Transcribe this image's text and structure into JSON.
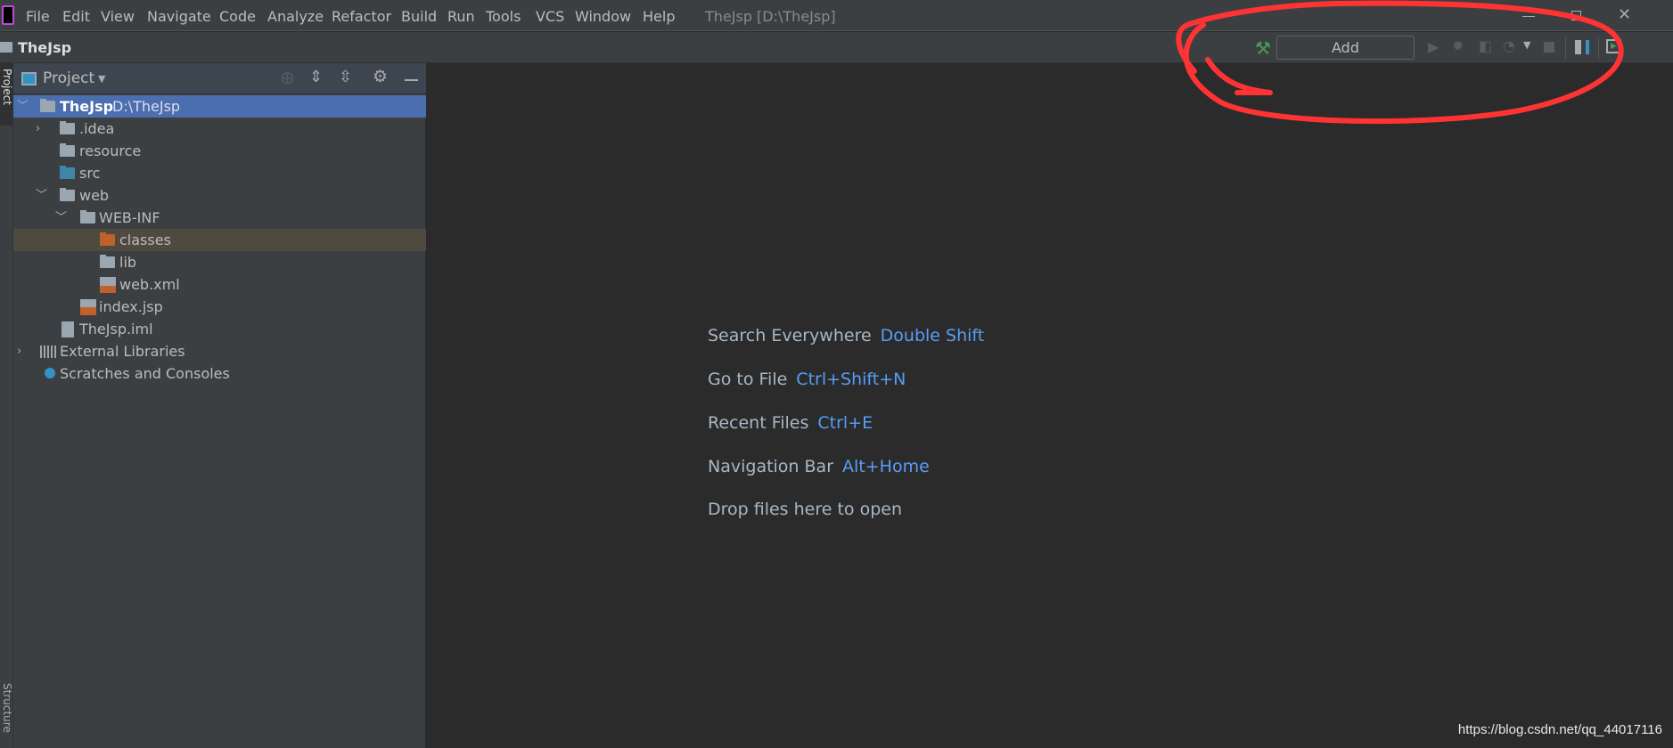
{
  "menubar": {
    "items": [
      "File",
      "Edit",
      "View",
      "Navigate",
      "Code",
      "Analyze",
      "Refactor",
      "Build",
      "Run",
      "Tools",
      "VCS",
      "Window",
      "Help"
    ],
    "window_title": "TheJsp [D:\\TheJsp]"
  },
  "toolbar": {
    "project_name": "TheJsp",
    "add_configuration": "Add Configuration..."
  },
  "panel": {
    "title": "Project",
    "tool_strip_top": "Project",
    "tool_strip_bottom": "Structure"
  },
  "tree": [
    {
      "label": "TheJsp",
      "path": "D:\\TheJsp"
    },
    {
      "label": ".idea"
    },
    {
      "label": "resource"
    },
    {
      "label": "src"
    },
    {
      "label": "web"
    },
    {
      "label": "WEB-INF"
    },
    {
      "label": "classes"
    },
    {
      "label": "lib"
    },
    {
      "label": "web.xml"
    },
    {
      "label": "index.jsp"
    },
    {
      "label": "TheJsp.iml"
    },
    {
      "label": "External Libraries"
    },
    {
      "label": "Scratches and Consoles"
    }
  ],
  "hints": [
    {
      "label": "Search Everywhere",
      "key": "Double Shift"
    },
    {
      "label": "Go to File",
      "key": "Ctrl+Shift+N"
    },
    {
      "label": "Recent Files",
      "key": "Ctrl+E"
    },
    {
      "label": "Navigation Bar",
      "key": "Alt+Home"
    },
    {
      "label": "Drop files here to open",
      "key": ""
    }
  ],
  "watermark": "https://blog.csdn.net/qq_44017116",
  "colors": {
    "selection": "#4b6eaf",
    "link": "#589df6",
    "annotation": "#ff3333"
  }
}
